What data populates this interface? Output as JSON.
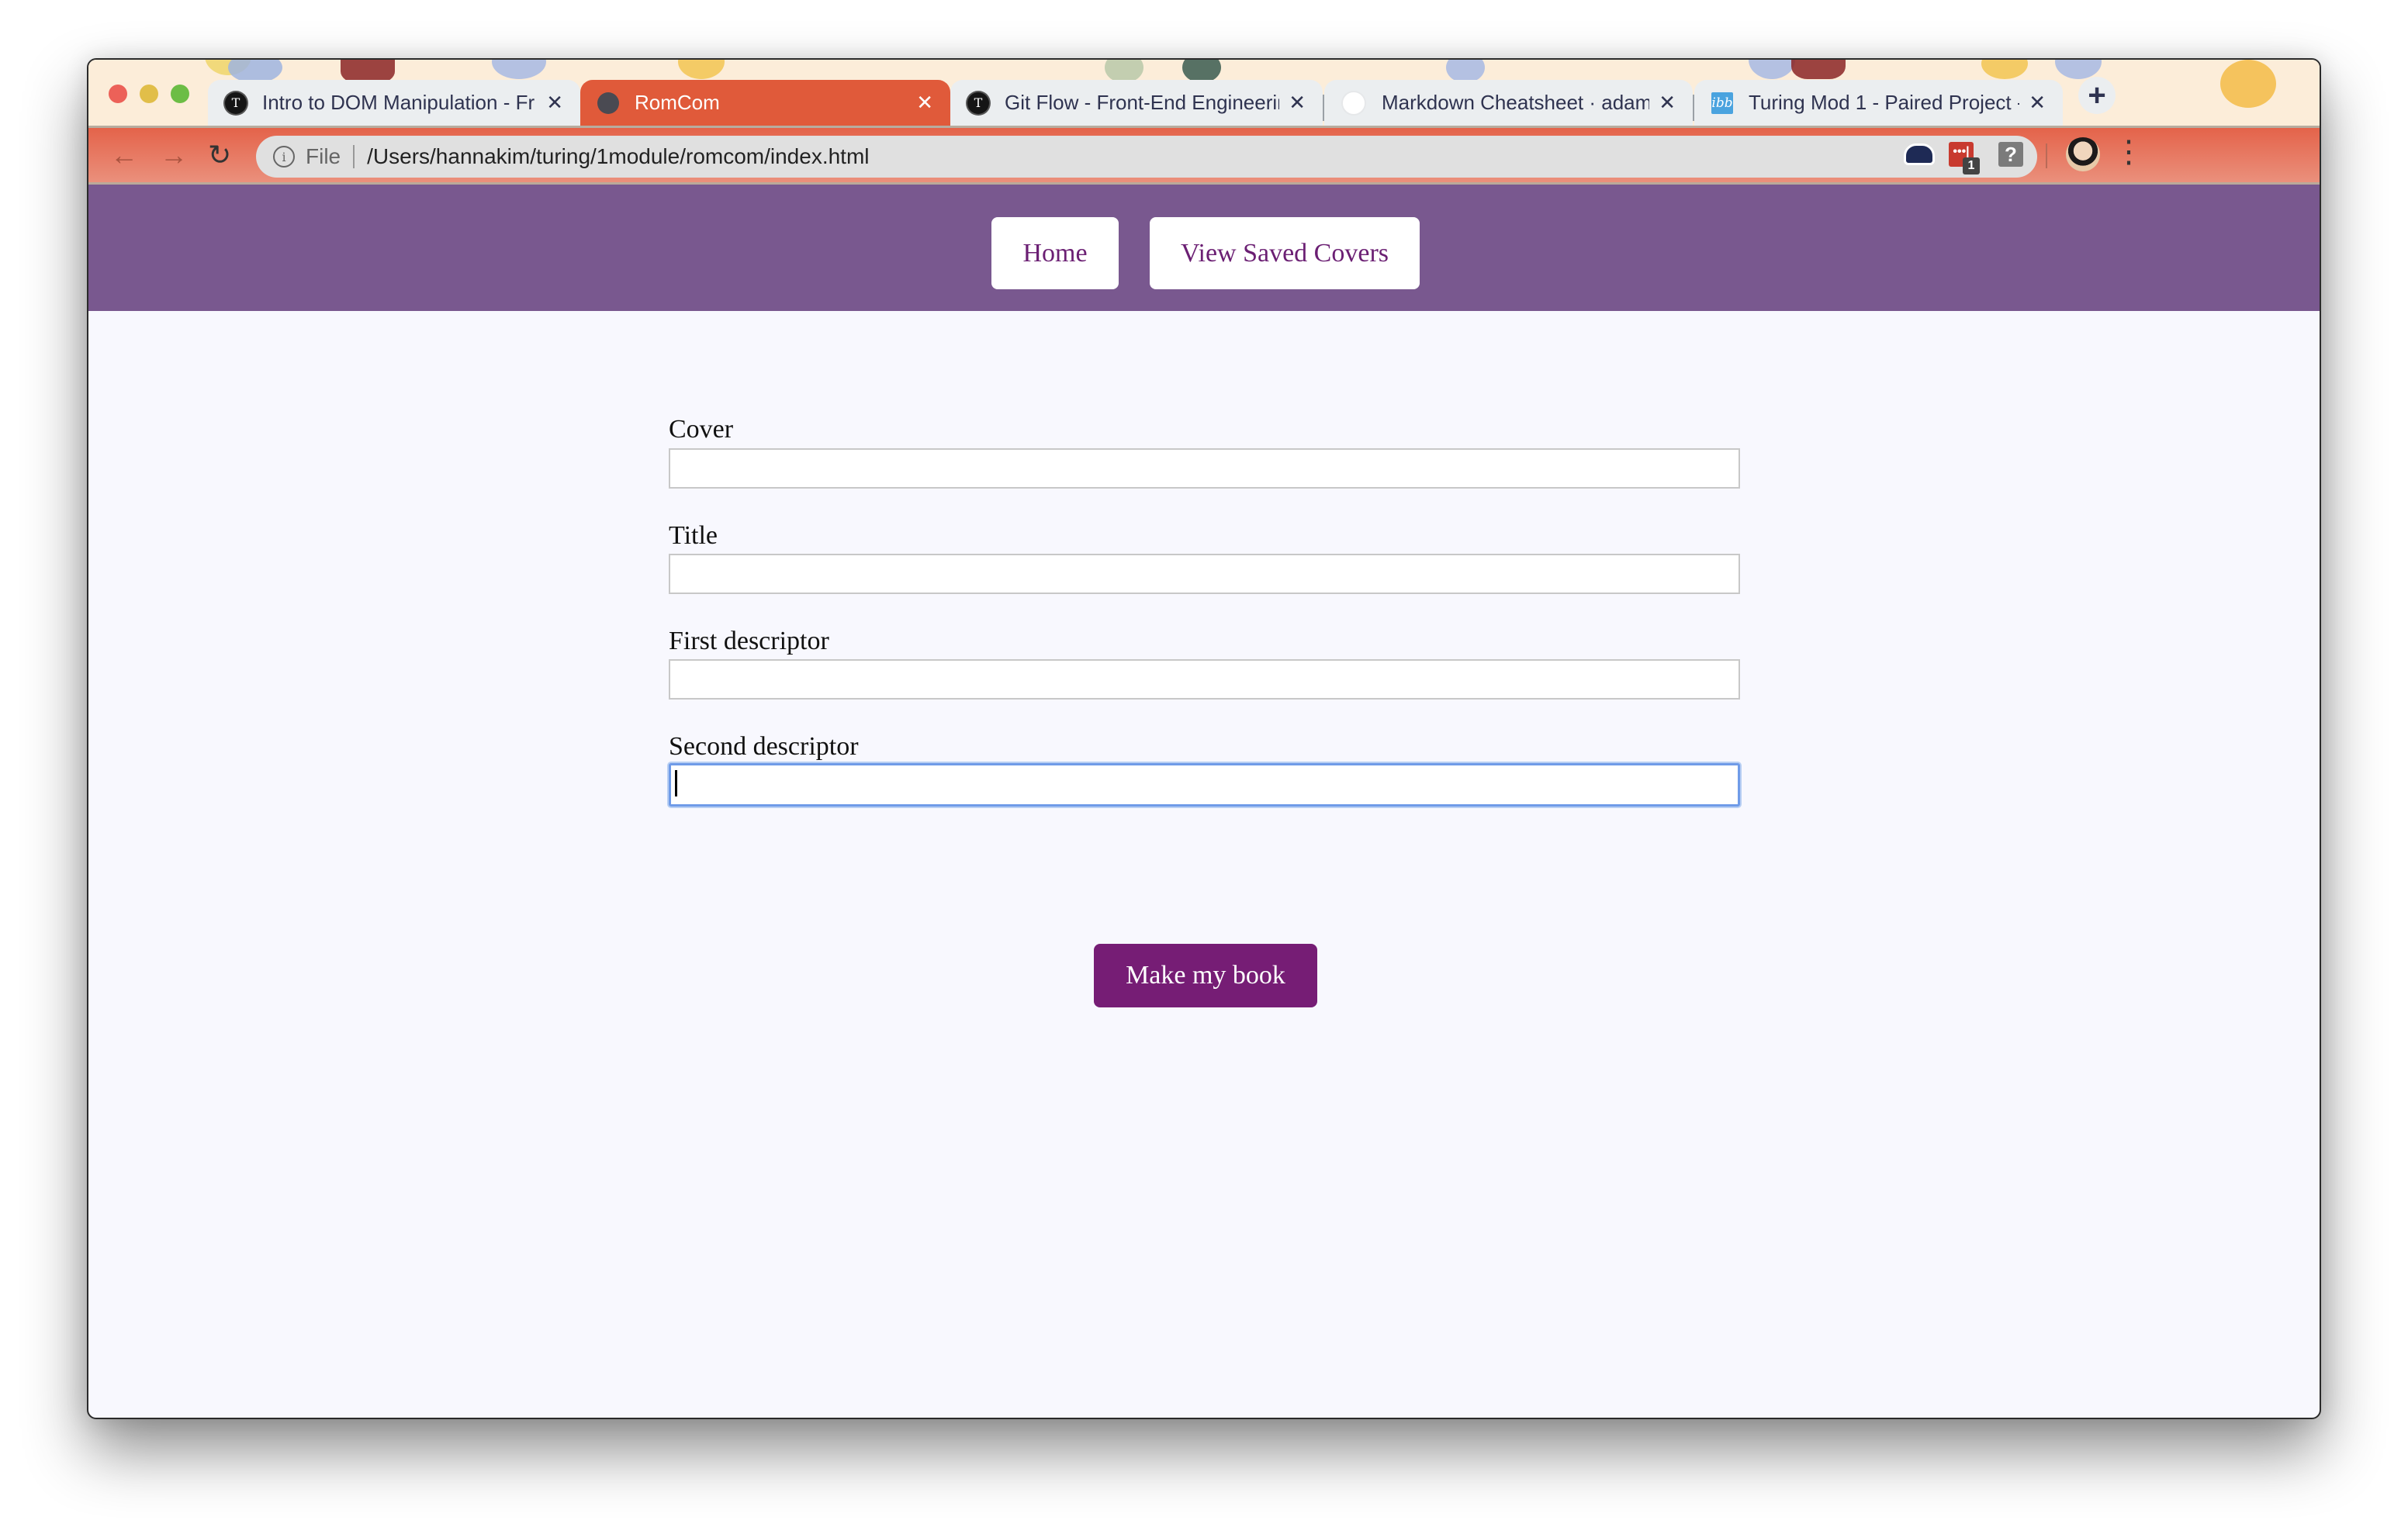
{
  "browser": {
    "tabs": [
      {
        "title": "Intro to DOM Manipulation - Fr",
        "favicon": "turing-icon",
        "active": false
      },
      {
        "title": "RomCom",
        "favicon": "globe-icon",
        "active": true
      },
      {
        "title": "Git Flow - Front-End Engineerir",
        "favicon": "turing-icon",
        "active": false
      },
      {
        "title": "Markdown Cheatsheet · adam-",
        "favicon": "github-icon",
        "active": false
      },
      {
        "title": "Turing Mod 1 - Paired Project -",
        "favicon": "ibb-icon",
        "active": false
      }
    ],
    "tab_close_glyph": "✕",
    "new_tab_glyph": "+",
    "favicon_glyphs": {
      "turing": "T",
      "ibb": "ibb"
    },
    "nav": {
      "back": "←",
      "forward": "→",
      "reload": "↻"
    },
    "address_bar": {
      "info_glyph": "i",
      "scheme_label": "File",
      "url": "/Users/hannakim/turing/1module/romcom/index.html",
      "star_glyph": "☆"
    },
    "extensions": {
      "lastpass_glyph": "•••|",
      "lastpass_badge": "1",
      "help_glyph": "?"
    },
    "menu_glyph": "⋮",
    "colors": {
      "active_tab": "#e05a3a",
      "toolbar": "#e4634a",
      "tabstrip_bg": "#fcedd9"
    }
  },
  "page": {
    "header": {
      "home_label": "Home",
      "view_saved_label": "View Saved Covers",
      "bg_color": "#79588f",
      "button_text_color": "#6b1f73"
    },
    "form": {
      "fields": [
        {
          "label": "Cover",
          "value": ""
        },
        {
          "label": "Title",
          "value": ""
        },
        {
          "label": "First descriptor",
          "value": ""
        },
        {
          "label": "Second descriptor",
          "value": "",
          "focused": true
        }
      ],
      "submit_label": "Make my book",
      "submit_color": "#761d75"
    }
  }
}
